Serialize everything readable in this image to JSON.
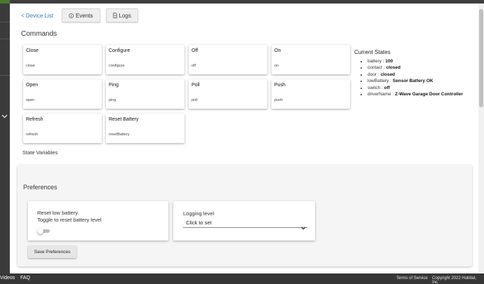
{
  "nav": {
    "back_label": "< Device List",
    "events_label": "Events",
    "logs_label": "Logs"
  },
  "commands": {
    "title": "Commands",
    "items": [
      {
        "name": "Close",
        "command": "close"
      },
      {
        "name": "Configure",
        "command": "configure"
      },
      {
        "name": "Off",
        "command": "off"
      },
      {
        "name": "On",
        "command": "on"
      },
      {
        "name": "Open",
        "command": "open"
      },
      {
        "name": "Ping",
        "command": "ping"
      },
      {
        "name": "Poll",
        "command": "poll"
      },
      {
        "name": "Push",
        "command": "push"
      },
      {
        "name": "Refresh",
        "command": "refresh"
      },
      {
        "name": "Reset Battery",
        "command": "resetBattery"
      }
    ]
  },
  "current_states": {
    "title": "Current States",
    "items": [
      {
        "key": "battery",
        "value": "100"
      },
      {
        "key": "contact",
        "value": "closed"
      },
      {
        "key": "door",
        "value": "closed"
      },
      {
        "key": "lowBattery",
        "value": "Sensor Battery OK"
      },
      {
        "key": "switch",
        "value": "off"
      },
      {
        "key": "driverName",
        "value": "Z-Wave Garage Door Controller"
      }
    ]
  },
  "state_variables": {
    "title": "State Variables"
  },
  "preferences": {
    "title": "Preferences",
    "reset_low_battery": {
      "line1": "Reset low battery.",
      "line2": "Toggle to reset battery level",
      "enabled": false
    },
    "logging_level": {
      "label": "Logging level",
      "value": "Click to set"
    },
    "save_label": "Save Preferences"
  },
  "footer": {
    "videos_label": "Videos",
    "faq_label": "FAQ",
    "terms_label": "Terms of Service",
    "copyright": "Copyright 2022 Hubitat, Inc."
  },
  "colors": {
    "link": "#2d7fc1",
    "nav_dark": "#3b3b3b",
    "footer": "#363636",
    "accent": "#4a7a2c"
  },
  "icons": {
    "events": "info-circle-icon",
    "logs": "document-icon",
    "logging_select": "chevron-down-icon",
    "nav_expand": "chevron-down-icon"
  }
}
